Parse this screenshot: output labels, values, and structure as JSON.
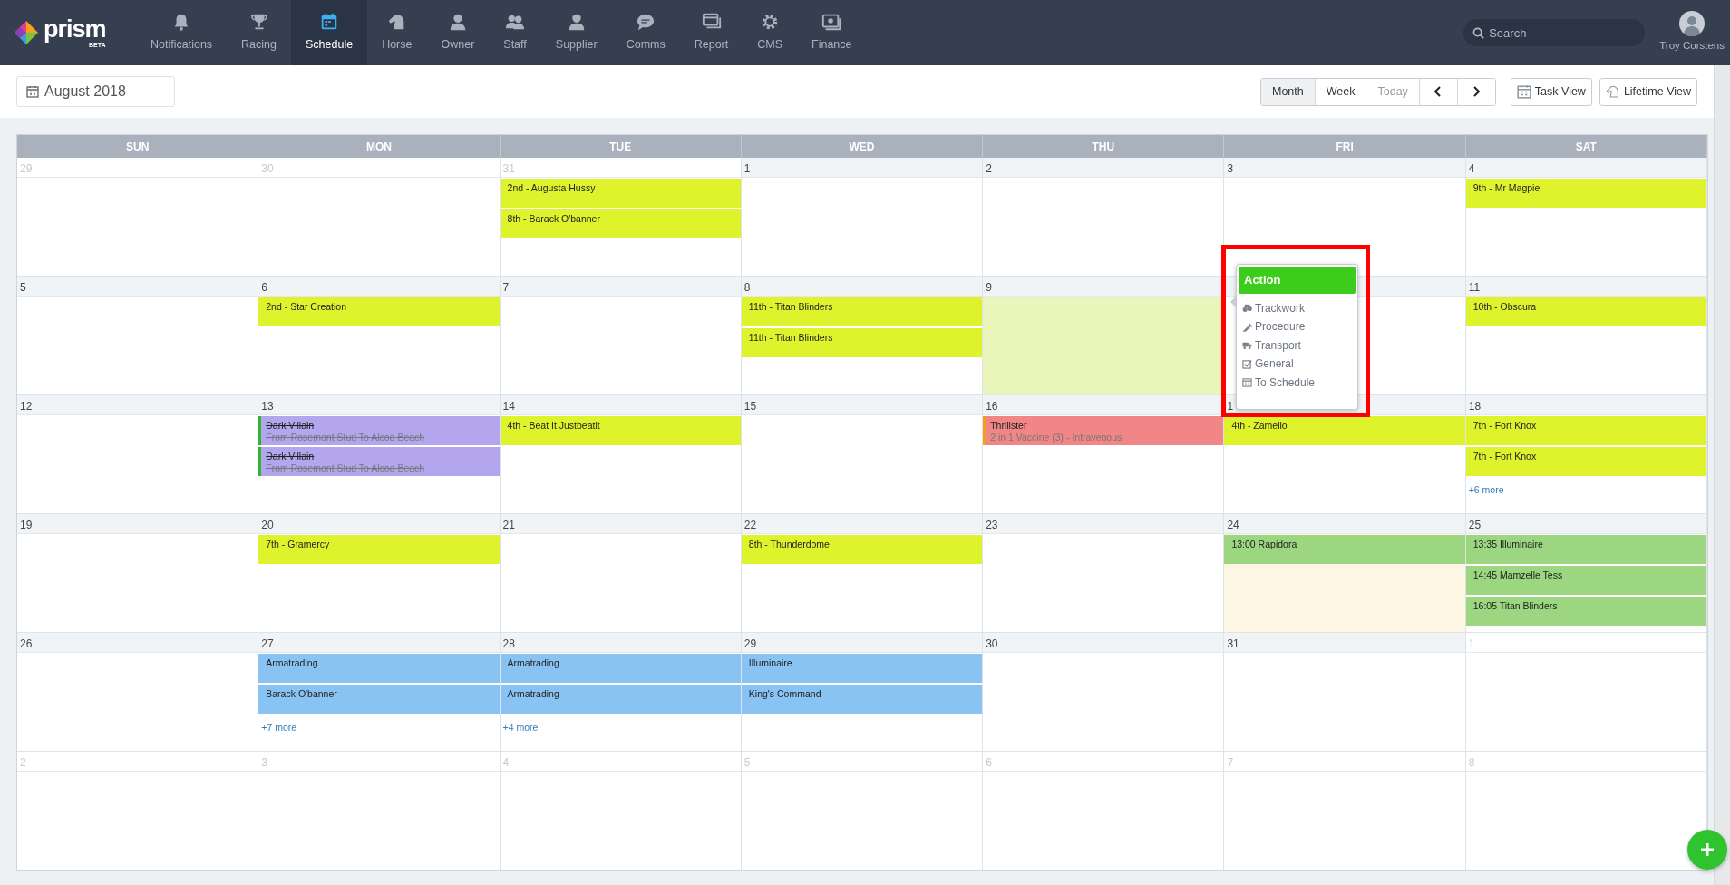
{
  "nav": {
    "logo": {
      "name": "prism",
      "tag": "BETA"
    },
    "items": [
      {
        "label": "Notifications",
        "selected": false
      },
      {
        "label": "Racing",
        "selected": false
      },
      {
        "label": "Schedule",
        "selected": true
      },
      {
        "label": "Horse",
        "selected": false
      },
      {
        "label": "Owner",
        "selected": false
      },
      {
        "label": "Staff",
        "selected": false
      },
      {
        "label": "Supplier",
        "selected": false
      },
      {
        "label": "Comms",
        "selected": false
      },
      {
        "label": "Report",
        "selected": false
      },
      {
        "label": "CMS",
        "selected": false
      },
      {
        "label": "Finance",
        "selected": false
      }
    ],
    "search": {
      "placeholder": "Search"
    },
    "user": {
      "name": "Troy Corstens"
    }
  },
  "toolbar": {
    "period": "August 2018",
    "views": [
      {
        "label": "Month",
        "selected": true,
        "disabled": false
      },
      {
        "label": "Week",
        "selected": false,
        "disabled": false
      },
      {
        "label": "Today",
        "selected": false,
        "disabled": true
      }
    ],
    "extra_buttons": [
      "Task View",
      "Lifetime View"
    ]
  },
  "calendar": {
    "weekdays": [
      "SUN",
      "MON",
      "TUE",
      "WED",
      "THU",
      "FRI",
      "SAT"
    ],
    "weeks": [
      {
        "days": [
          {
            "number": "29",
            "muted": true
          },
          {
            "number": "30",
            "muted": true
          },
          {
            "number": "31",
            "muted": true,
            "events": [
              {
                "title": "2nd - Augusta Hussy",
                "color": "#def32b"
              },
              {
                "title": "8th - Barack O'banner",
                "color": "#def32b"
              }
            ]
          },
          {
            "number": "1",
            "muted": false
          },
          {
            "number": "2",
            "muted": false
          },
          {
            "number": "3",
            "muted": false
          },
          {
            "number": "4",
            "muted": false,
            "events": [
              {
                "title": "9th - Mr Magpie",
                "color": "#def32b"
              }
            ]
          }
        ]
      },
      {
        "days": [
          {
            "number": "5",
            "muted": false
          },
          {
            "number": "6",
            "muted": false,
            "events": [
              {
                "title": "2nd - Star Creation",
                "color": "#def32b"
              }
            ]
          },
          {
            "number": "7",
            "muted": false
          },
          {
            "number": "8",
            "muted": false,
            "events": [
              {
                "title": "11th - Titan Blinders",
                "color": "#def32b"
              },
              {
                "title": "11th - Titan Blinders",
                "color": "#def32b"
              }
            ]
          },
          {
            "number": "9",
            "muted": false,
            "color": "#e9f5b9"
          },
          {
            "muted": false
          },
          {
            "number": "11",
            "muted": false,
            "events": [
              {
                "title": "10th - Obscura",
                "color": "#def32b"
              }
            ]
          }
        ]
      },
      {
        "days": [
          {
            "number": "12",
            "muted": false
          },
          {
            "number": "13",
            "muted": false,
            "events": [
              {
                "title": "Dark Villain",
                "subtitle": "From Rosemont Stud To Alcoa Beach",
                "color": "#b3a6ee",
                "stripe": {
                  "color": "#2fb52f"
                },
                "struck": true
              },
              {
                "title": "Dark Villain",
                "subtitle": "From Rosemont Stud To Alcoa Beach",
                "color": "#b3a6ee",
                "stripe": {
                  "color": "#2fb52f"
                },
                "struck": true
              }
            ]
          },
          {
            "number": "14",
            "muted": false,
            "events": [
              {
                "title": "4th - Beat It Justbeatit",
                "color": "#def32b"
              }
            ]
          },
          {
            "number": "15",
            "muted": false
          },
          {
            "number": "16",
            "muted": false,
            "events": [
              {
                "title": "Thrillster",
                "subtitle": "2 in 1 Vaccine (3) - Intravenous",
                "color": "#f28585",
                "stripe": {
                  "color": "#f0a020"
                },
                "struck": false
              }
            ]
          },
          {
            "number": "1",
            "muted": false,
            "events": [
              {
                "title": "4th - Zamello",
                "color": "#def32b"
              }
            ]
          },
          {
            "number": "18",
            "muted": false,
            "events": [
              {
                "title": "7th - Fort Knox",
                "color": "#def32b"
              },
              {
                "title": "7th - Fort Knox",
                "color": "#def32b"
              }
            ],
            "more": "+6 more"
          }
        ]
      },
      {
        "days": [
          {
            "number": "19",
            "muted": false
          },
          {
            "number": "20",
            "muted": false,
            "events": [
              {
                "title": "7th - Gramercy",
                "color": "#def32b"
              }
            ]
          },
          {
            "number": "21",
            "muted": false
          },
          {
            "number": "22",
            "muted": false,
            "events": [
              {
                "title": "8th - Thunderdome",
                "color": "#def32b"
              }
            ]
          },
          {
            "number": "23",
            "muted": false
          },
          {
            "number": "24",
            "muted": false,
            "color": "#fcf6e3",
            "events": [
              {
                "title": "13:00 Rapidora",
                "color": "#9cd680"
              }
            ]
          },
          {
            "number": "25",
            "muted": false,
            "events": [
              {
                "title": "13:35 Illuminaire",
                "color": "#9cd680"
              },
              {
                "title": "14:45 Mamzelle Tess",
                "color": "#9cd680"
              },
              {
                "title": "16:05 Titan Blinders",
                "color": "#9cd680"
              }
            ]
          }
        ]
      },
      {
        "days": [
          {
            "number": "26",
            "muted": false
          },
          {
            "number": "27",
            "muted": false,
            "events": [
              {
                "title": "Armatrading",
                "color": "#89c3f3"
              },
              {
                "title": "Barack O'banner",
                "color": "#89c3f3"
              }
            ],
            "more": "+7 more"
          },
          {
            "number": "28",
            "muted": false,
            "events": [
              {
                "title": "Armatrading",
                "color": "#89c3f3"
              },
              {
                "title": "Armatrading",
                "color": "#89c3f3"
              }
            ],
            "more": "+4 more"
          },
          {
            "number": "29",
            "muted": false,
            "events": [
              {
                "title": "Illuminaire",
                "color": "#89c3f3"
              },
              {
                "title": "King's Command",
                "color": "#89c3f3"
              }
            ]
          },
          {
            "number": "30",
            "muted": false
          },
          {
            "number": "31",
            "muted": false
          },
          {
            "number": "1",
            "muted": true
          }
        ]
      },
      {
        "days": [
          {
            "number": "2",
            "muted": true
          },
          {
            "number": "3",
            "muted": true
          },
          {
            "number": "4",
            "muted": true
          },
          {
            "number": "5",
            "muted": true
          },
          {
            "number": "6",
            "muted": true
          },
          {
            "number": "7",
            "muted": true
          },
          {
            "number": "8",
            "muted": true
          }
        ]
      }
    ]
  },
  "action_popup": {
    "title": "Action",
    "highlighted": true,
    "items": [
      "Trackwork",
      "Procedure",
      "Transport",
      "General",
      "To Schedule"
    ]
  }
}
